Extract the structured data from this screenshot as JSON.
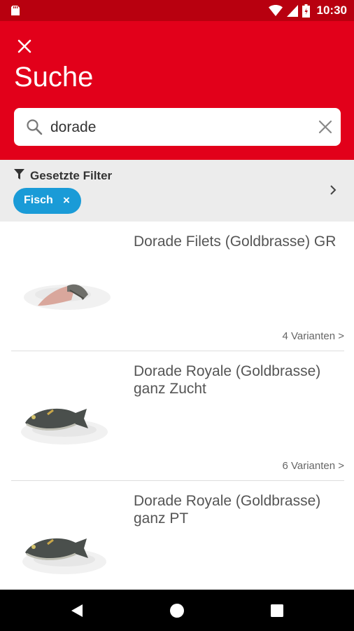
{
  "status_bar": {
    "time": "10:30"
  },
  "header": {
    "title": "Suche"
  },
  "search": {
    "value": "dorade"
  },
  "filters": {
    "title": "Gesetzte Filter",
    "chips": [
      {
        "label": "Fisch",
        "remove": "×"
      }
    ]
  },
  "results": [
    {
      "title": "Dorade Filets (Goldbrasse) GR",
      "variants": "4 Varianten >"
    },
    {
      "title": "Dorade Royale (Goldbrasse) ganz Zucht",
      "variants": "6 Varianten >"
    },
    {
      "title": "Dorade Royale (Goldbrasse) ganz PT",
      "variants": ""
    }
  ],
  "colors": {
    "primary_red": "#e2001a",
    "status_red": "#b8000f",
    "chip_blue": "#1a9bd7",
    "filter_bg": "#ececec"
  },
  "icons": {
    "status": [
      "sd-card-icon",
      "wifi-icon",
      "signal-icon",
      "battery-icon"
    ],
    "nav": [
      "back-icon",
      "home-icon",
      "recents-icon"
    ]
  }
}
